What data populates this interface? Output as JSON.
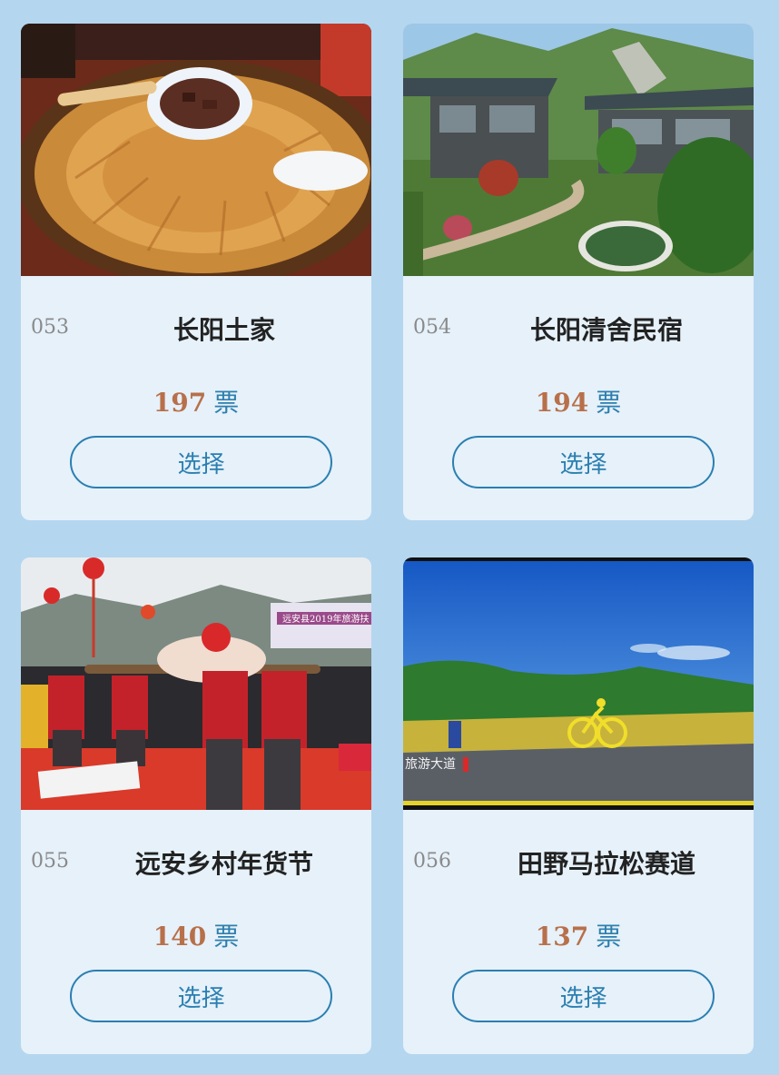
{
  "cards": [
    {
      "number": "053",
      "name": "长阳土家",
      "votes": "197",
      "unit": "票",
      "button": "选择"
    },
    {
      "number": "054",
      "name": "长阳清舍民宿",
      "votes": "194",
      "unit": "票",
      "button": "选择"
    },
    {
      "number": "055",
      "name": "远安乡村年货节",
      "votes": "140",
      "unit": "票",
      "button": "选择",
      "photo_banner": "远安县2019年旅游扶"
    },
    {
      "number": "056",
      "name": "田野马拉松赛道",
      "votes": "137",
      "unit": "票",
      "button": "选择",
      "photo_sign": "旅游大道"
    }
  ],
  "colors": {
    "page_bg": "#b5d6ef",
    "card_bg": "#e6f1fa",
    "accent": "#2b7fb0",
    "votes": "#b8704a"
  }
}
